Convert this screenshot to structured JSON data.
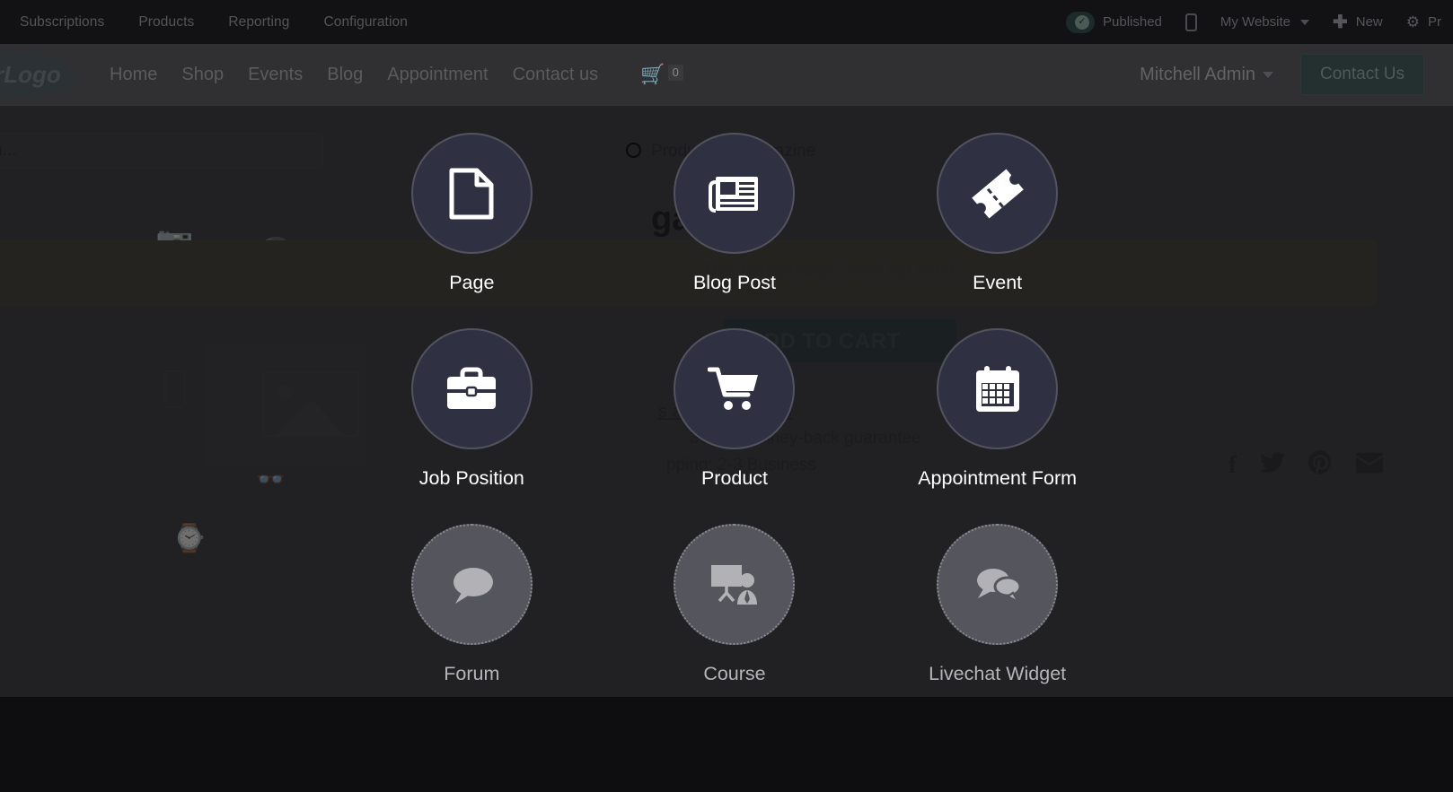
{
  "backend_bar": {
    "menu_items": [
      {
        "label": "Subscriptions"
      },
      {
        "label": "Products"
      },
      {
        "label": "Reporting"
      },
      {
        "label": "Configuration"
      }
    ],
    "publish_toggle": {
      "label": "Published",
      "icon": "check-circle-icon",
      "state": "on"
    },
    "mobile_preview": {
      "icon": "mobile-phone-icon"
    },
    "website_selector": {
      "label": "My Website",
      "icon": "chevron-down-icon"
    },
    "new_button": {
      "label": "New",
      "icon": "plus-icon"
    },
    "settings": {
      "icon": "gear-icon"
    },
    "promote_button": {
      "label": "Pr"
    }
  },
  "site_nav": {
    "logo_text": "urLogo",
    "links": [
      {
        "label": "Home"
      },
      {
        "label": "Shop"
      },
      {
        "label": "Events"
      },
      {
        "label": "Blog"
      },
      {
        "label": "Appointment"
      },
      {
        "label": "Contact us"
      }
    ],
    "cart": {
      "icon": "shopping-cart-icon",
      "count": "0"
    },
    "user": {
      "name": "Mitchell Admin",
      "icon": "chevron-down-icon"
    },
    "cta": {
      "label": "Contact Us"
    }
  },
  "page": {
    "search": {
      "placeholder": "earch...",
      "value": ""
    },
    "breadcrumb": {
      "parent": "Products",
      "separator": "/",
      "current": "Magazine"
    },
    "product_title": "gazine",
    "warning": "This combination does not exist.",
    "add_to_cart": "ADD TO CART",
    "terms_link": "s and Conditions",
    "guarantee": "30-day money-back guarantee",
    "shipping": "pping: 2-3 Business",
    "social": [
      {
        "name": "facebook-icon",
        "glyph": "f"
      },
      {
        "name": "twitter-icon",
        "glyph": "ᴠ"
      },
      {
        "name": "pinterest-icon",
        "glyph": "P"
      },
      {
        "name": "email-icon",
        "glyph": "✉"
      }
    ]
  },
  "content_picker": {
    "items": [
      {
        "label": "Page",
        "icon": "document-icon",
        "enabled": true
      },
      {
        "label": "Blog Post",
        "icon": "newspaper-icon",
        "enabled": true
      },
      {
        "label": "Event",
        "icon": "ticket-icon",
        "enabled": true
      },
      {
        "label": "Job Position",
        "icon": "briefcase-icon",
        "enabled": true
      },
      {
        "label": "Product",
        "icon": "shopping-cart-icon",
        "enabled": true
      },
      {
        "label": "Appointment Form",
        "icon": "calendar-icon",
        "enabled": true
      },
      {
        "label": "Forum",
        "icon": "speech-bubble-icon",
        "enabled": false
      },
      {
        "label": "Course",
        "icon": "presentation-icon",
        "enabled": false
      },
      {
        "label": "Livechat Widget",
        "icon": "chat-bubbles-icon",
        "enabled": false
      }
    ]
  },
  "colors": {
    "backend_bar_bg": "#121214",
    "site_nav_bg": "#303032",
    "page_bg": "#333335",
    "overlay_scrim": "rgba(18,18,20,0.55)",
    "circle_enabled": "#2f3041",
    "circle_disabled": "#55555d",
    "warning_banner": "#3b3830",
    "footer_bg": "#0e0e10"
  }
}
